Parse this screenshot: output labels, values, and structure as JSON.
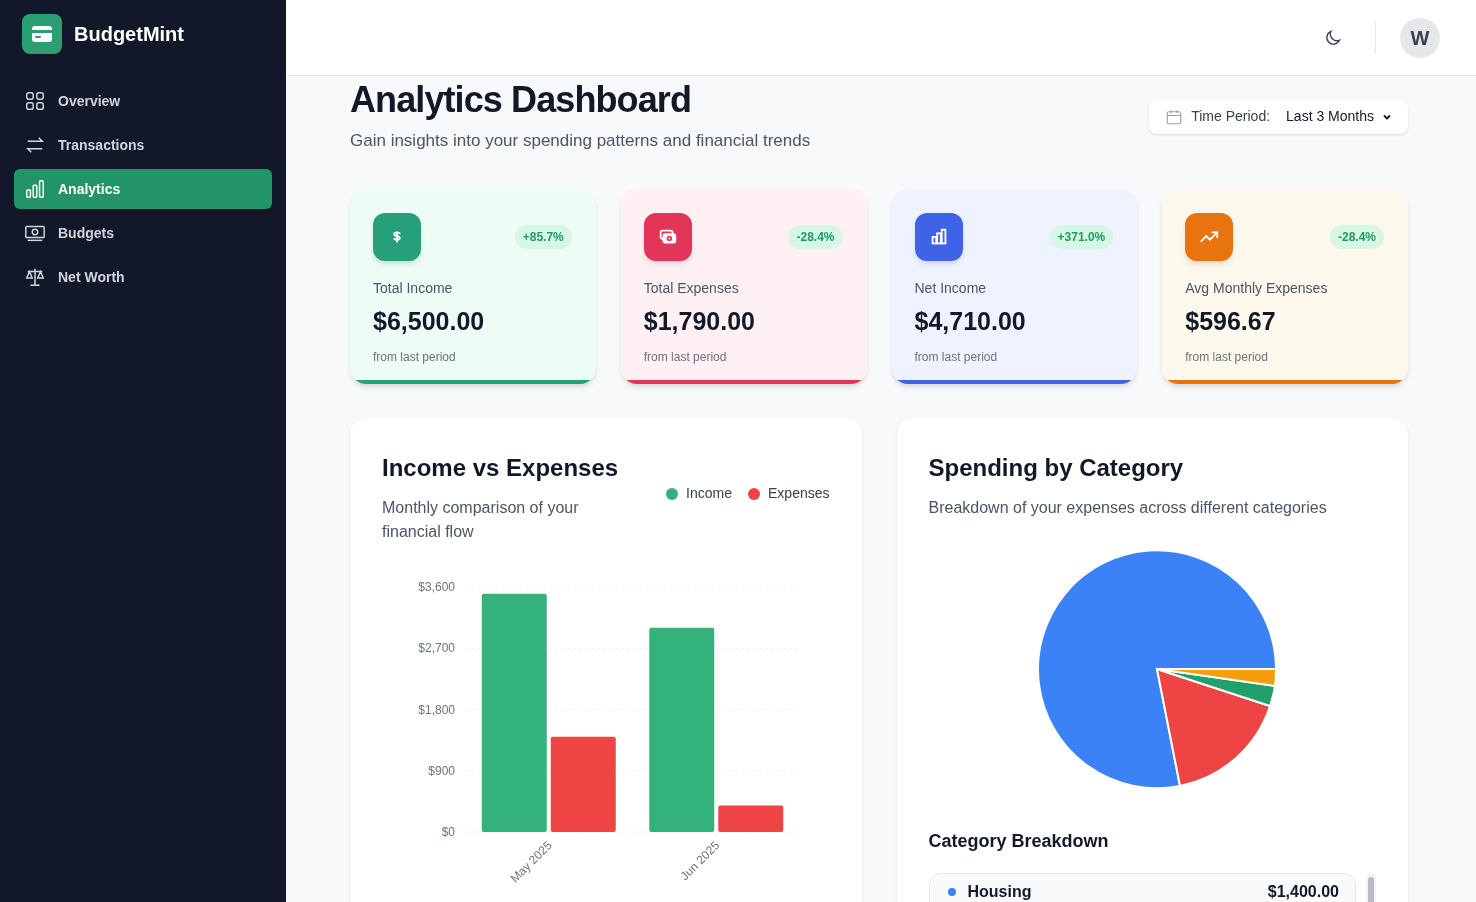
{
  "brand": {
    "name": "BudgetMint"
  },
  "nav": [
    {
      "label": "Overview",
      "selected": false
    },
    {
      "label": "Transactions",
      "selected": false
    },
    {
      "label": "Analytics",
      "selected": true
    },
    {
      "label": "Budgets",
      "selected": false
    },
    {
      "label": "Net Worth",
      "selected": false
    }
  ],
  "header": {
    "avatar": "W"
  },
  "page": {
    "title": "Analytics Dashboard",
    "subtitle": "Gain insights into your spending patterns and financial trends",
    "period_label": "Time Period:",
    "period_value": "Last 3 Months"
  },
  "stats": [
    {
      "kind": "income",
      "label": "Total Income",
      "value": "$6,500.00",
      "change": "+85.7%",
      "note": "from last period"
    },
    {
      "kind": "expenses",
      "label": "Total Expenses",
      "value": "$1,790.00",
      "change": "-28.4%",
      "note": "from last period"
    },
    {
      "kind": "net",
      "label": "Net Income",
      "value": "$4,710.00",
      "change": "+371.0%",
      "note": "from last period"
    },
    {
      "kind": "avg",
      "label": "Avg Monthly Expenses",
      "value": "$596.67",
      "change": "-28.4%",
      "note": "from last period"
    }
  ],
  "income_chart": {
    "title": "Income vs Expenses",
    "subtitle": "Monthly comparison of your financial flow",
    "chart_data": {
      "type": "bar",
      "grid": true,
      "categories": [
        "May 2025",
        "Jun 2025"
      ],
      "series": [
        {
          "name": "Income",
          "color": "#34b27b",
          "values": [
            3500,
            3000
          ]
        },
        {
          "name": "Expenses",
          "color": "#ef4444",
          "values": [
            1400,
            390
          ]
        }
      ],
      "ylim": [
        0,
        3600
      ],
      "yticks": [
        {
          "value": 0,
          "label": "$0"
        },
        {
          "value": 900,
          "label": "$900"
        },
        {
          "value": 1800,
          "label": "$1,800"
        },
        {
          "value": 2700,
          "label": "$2,700"
        },
        {
          "value": 3600,
          "label": "$3,600"
        }
      ]
    }
  },
  "category_chart": {
    "title": "Spending by Category",
    "subtitle": "Breakdown of your expenses across different categories",
    "breakdown_title": "Category Breakdown",
    "items": [
      {
        "name": "Housing",
        "amount": "$1,400.00",
        "color": "#3b82f6"
      }
    ]
  }
}
